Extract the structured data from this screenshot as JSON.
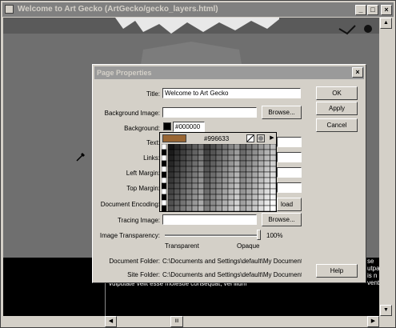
{
  "window": {
    "title": "Welcome to Art Gecko (ArtGecko/gecko_layers.html)",
    "controls": {
      "minimize": "_",
      "maximize": "□",
      "close": "×"
    }
  },
  "doc": {
    "body_text": [
      "se",
      "utpat",
      "is n",
      "vent"
    ],
    "bottom_text": "vulputate velit esse molestie consequat, vel illum"
  },
  "dialog": {
    "title": "Page Properties",
    "close": "×",
    "fields": {
      "title_label": "Title:",
      "title_value": "Welcome to Art Gecko",
      "bg_image_label": "Background Image:",
      "bg_image_value": "",
      "bg_label": "Background:",
      "bg_value": "#000000",
      "text_label": "Text:",
      "links_label": "Links:",
      "left_margin_label": "Left Margin:",
      "top_margin_label": "Top Margin:",
      "encoding_label": "Document Encoding:",
      "tracing_label": "Tracing Image:",
      "tracing_value": "",
      "transparency_label": "Image Transparency:",
      "transparency_value": "100%",
      "transparency_level": 1.0,
      "transparent": "Transparent",
      "opaque": "Opaque",
      "doc_folder_label": "Document Folder:",
      "doc_folder_value": "C:\\Documents and Settings\\default\\My Documents\\",
      "site_folder_label": "Site Folder:",
      "site_folder_value": "C:\\Documents and Settings\\default\\My Documents\\"
    },
    "buttons": {
      "ok": "OK",
      "apply": "Apply",
      "cancel": "Cancel",
      "help": "Help",
      "browse": "Browse...",
      "browse2": "Browse...",
      "reload": "load"
    },
    "picker": {
      "hex": "#996633",
      "arrow": "▶"
    }
  },
  "scroll": {
    "up": "▲",
    "down": "▼",
    "left": "◀",
    "right": "▶",
    "grip": "III"
  }
}
